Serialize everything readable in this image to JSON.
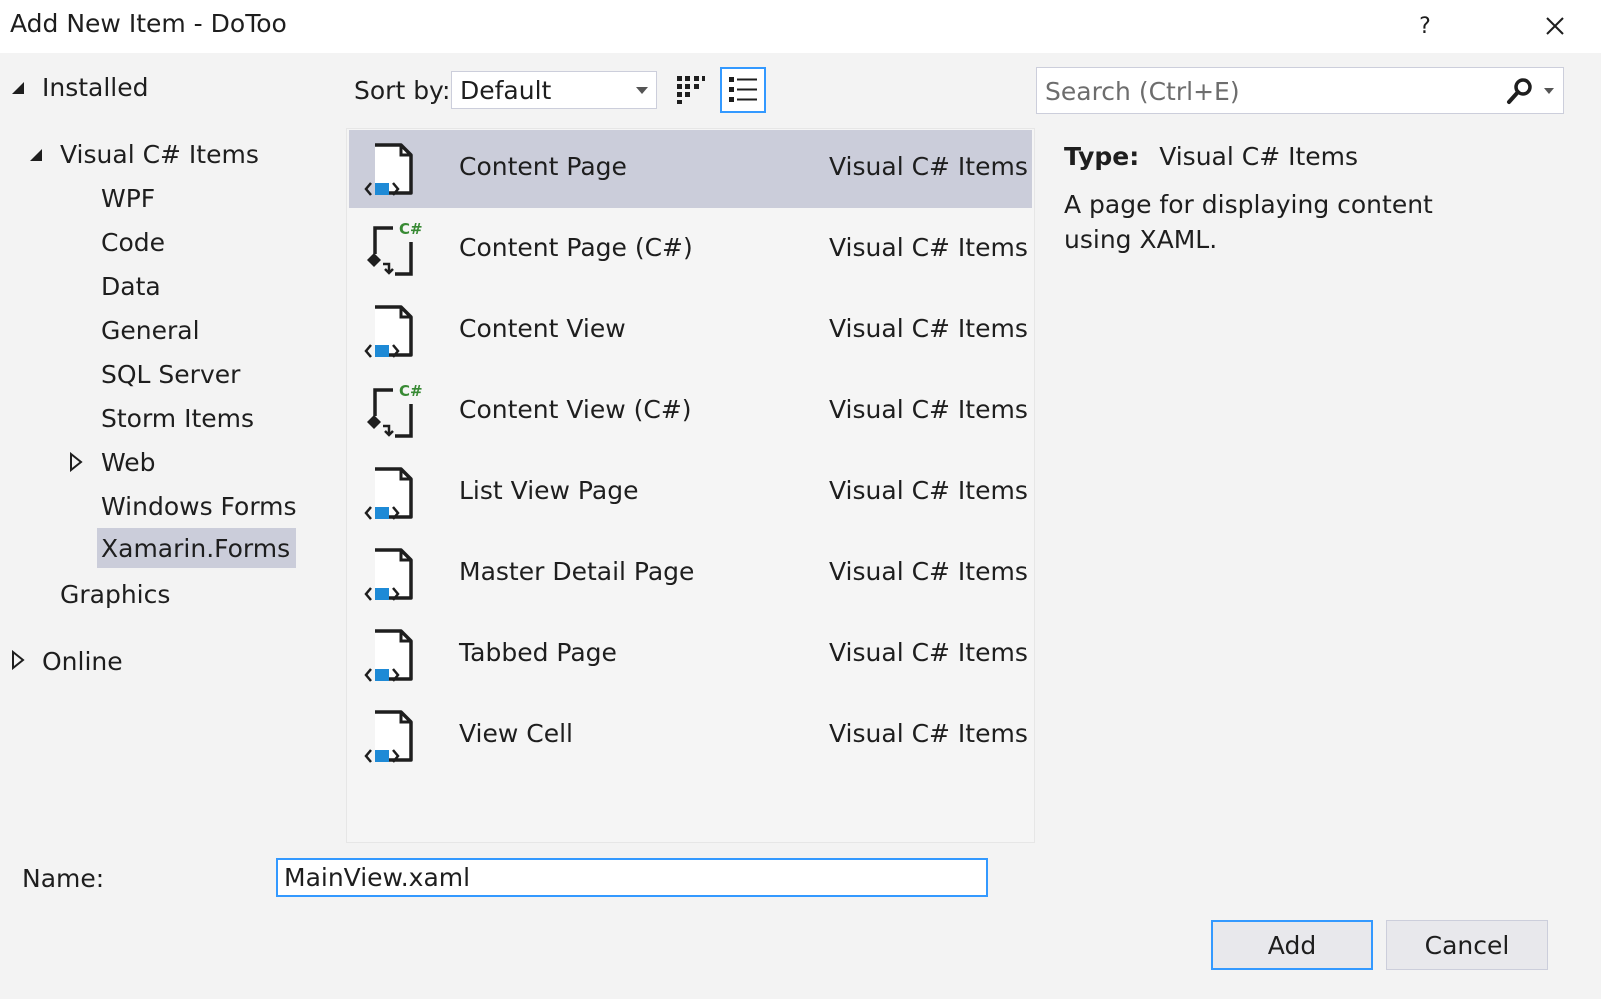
{
  "window": {
    "title": "Add New Item - DoToo",
    "help_label": "?"
  },
  "tree": {
    "installed": "Installed",
    "visual_csharp": "Visual C# Items",
    "children": [
      "WPF",
      "Code",
      "Data",
      "General",
      "SQL Server",
      "Storm Items",
      "Web",
      "Windows Forms",
      "Xamarin.Forms"
    ],
    "graphics": "Graphics",
    "online": "Online",
    "selected": "Xamarin.Forms"
  },
  "toolbar": {
    "sort_label": "Sort by:",
    "sort_value": "Default",
    "active_view": "list"
  },
  "search": {
    "placeholder": "Search (Ctrl+E)"
  },
  "items": [
    {
      "name": "Content Page",
      "type": "Visual C# Items",
      "icon": "xaml-page-icon",
      "selected": true
    },
    {
      "name": "Content Page (C#)",
      "type": "Visual C# Items",
      "icon": "csharp-page-icon"
    },
    {
      "name": "Content View",
      "type": "Visual C# Items",
      "icon": "xaml-page-icon"
    },
    {
      "name": "Content View (C#)",
      "type": "Visual C# Items",
      "icon": "csharp-page-icon"
    },
    {
      "name": "List View Page",
      "type": "Visual C# Items",
      "icon": "xaml-page-icon"
    },
    {
      "name": "Master Detail Page",
      "type": "Visual C# Items",
      "icon": "xaml-page-icon"
    },
    {
      "name": "Tabbed Page",
      "type": "Visual C# Items",
      "icon": "xaml-page-icon"
    },
    {
      "name": "View Cell",
      "type": "Visual C# Items",
      "icon": "xaml-page-icon"
    }
  ],
  "details": {
    "type_label": "Type:",
    "type_value": "Visual C# Items",
    "description": "A page for displaying content using XAML."
  },
  "footer": {
    "name_label": "Name:",
    "name_value": "MainView.xaml",
    "add_label": "Add",
    "cancel_label": "Cancel"
  },
  "colors": {
    "accent": "#3399ff",
    "selection": "#cbcdda",
    "icon_blue": "#1e8ad6",
    "csharp_green": "#388a34"
  }
}
